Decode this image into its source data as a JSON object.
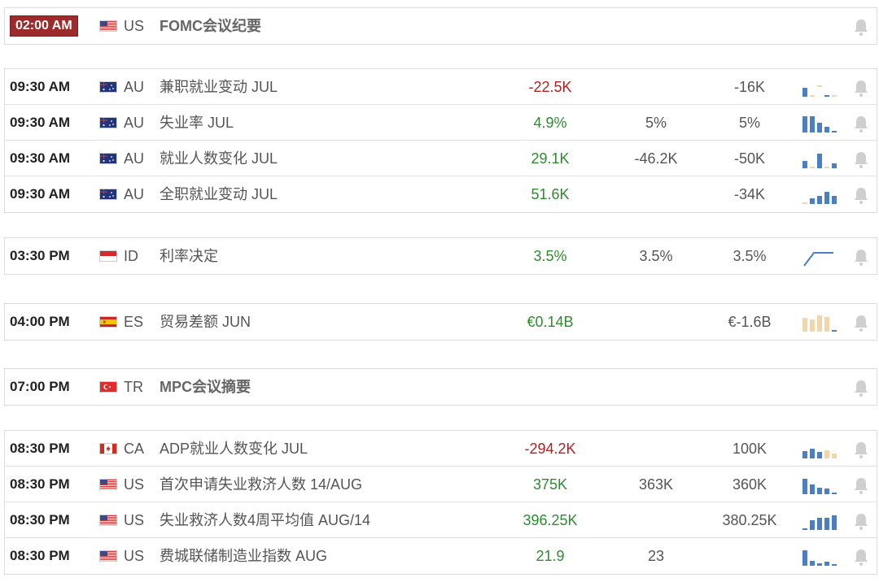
{
  "groups": [
    {
      "rows": [
        {
          "time": "02:00 AM",
          "highlight": true,
          "flag": "us",
          "country": "US",
          "event": "FOMC会议纪要",
          "bold": true,
          "actual": "",
          "forecast": "",
          "previous": "",
          "trend": "neg",
          "spark": []
        }
      ]
    },
    {
      "rows": [
        {
          "time": "09:30 AM",
          "flag": "au",
          "country": "AU",
          "event": "兼职就业变动 JUL",
          "actual": "-22.5K",
          "forecast": "",
          "previous": "-16K",
          "trend": "neg",
          "spark": [
            0.55,
            0.05,
            -0.35,
            0.08,
            0.08
          ],
          "sparkColors": [
            "b",
            "t",
            "t",
            "b",
            "t"
          ]
        },
        {
          "time": "09:30 AM",
          "flag": "au",
          "country": "AU",
          "event": "失业率 JUL",
          "actual": "4.9%",
          "forecast": "5%",
          "previous": "5%",
          "trend": "pos",
          "spark": [
            1.0,
            1.0,
            0.6,
            0.35,
            0.1
          ],
          "sparkColors": [
            "b",
            "b",
            "b",
            "b",
            "b"
          ]
        },
        {
          "time": "09:30 AM",
          "flag": "au",
          "country": "AU",
          "event": "就业人数变化 JUL",
          "actual": "29.1K",
          "forecast": "-46.2K",
          "previous": "-50K",
          "trend": "pos",
          "spark": [
            0.45,
            0.06,
            0.9,
            0.06,
            0.3
          ],
          "sparkColors": [
            "b",
            "t",
            "b",
            "t",
            "b"
          ]
        },
        {
          "time": "09:30 AM",
          "flag": "au",
          "country": "AU",
          "event": "全职就业变动 JUL",
          "actual": "51.6K",
          "forecast": "",
          "previous": "-34K",
          "trend": "pos",
          "spark": [
            0.1,
            0.35,
            0.5,
            0.75,
            0.5
          ],
          "sparkColors": [
            "t",
            "b",
            "b",
            "b",
            "b"
          ]
        }
      ]
    },
    {
      "rows": [
        {
          "time": "03:30 PM",
          "flag": "id",
          "country": "ID",
          "event": "利率决定",
          "actual": "3.5%",
          "forecast": "3.5%",
          "previous": "3.5%",
          "trend": "pos",
          "spark": "line"
        }
      ]
    },
    {
      "rows": [
        {
          "time": "04:00 PM",
          "flag": "es",
          "country": "ES",
          "event": "贸易差额 JUN",
          "actual": "€0.14B",
          "forecast": "",
          "previous": "€-1.6B",
          "trend": "pos",
          "spark": [
            0.85,
            0.75,
            1.0,
            0.9,
            0.1
          ],
          "sparkColors": [
            "t",
            "t",
            "t",
            "t",
            "b"
          ]
        }
      ]
    },
    {
      "rows": [
        {
          "time": "07:00 PM",
          "flag": "tr",
          "country": "TR",
          "event": "MPC会议摘要",
          "bold": true,
          "actual": "",
          "forecast": "",
          "previous": "",
          "trend": "neg",
          "spark": []
        }
      ]
    },
    {
      "rows": [
        {
          "time": "08:30 PM",
          "flag": "ca",
          "country": "CA",
          "event": "ADP就业人数变化 JUL",
          "actual": "-294.2K",
          "forecast": "",
          "previous": "100K",
          "trend": "neg",
          "spark": [
            0.45,
            0.6,
            0.4,
            0.5,
            0.3
          ],
          "sparkColors": [
            "b",
            "b",
            "b",
            "t",
            "t"
          ]
        },
        {
          "time": "08:30 PM",
          "flag": "us",
          "country": "US",
          "event": "首次申请失业救济人数 14/AUG",
          "actual": "375K",
          "forecast": "363K",
          "previous": "360K",
          "trend": "pos",
          "spark": [
            0.95,
            0.6,
            0.4,
            0.35,
            0.1
          ],
          "sparkColors": [
            "b",
            "b",
            "b",
            "b",
            "b"
          ]
        },
        {
          "time": "08:30 PM",
          "flag": "us",
          "country": "US",
          "event": "失业救济人数4周平均值 AUG/14",
          "actual": "396.25K",
          "forecast": "",
          "previous": "380.25K",
          "trend": "pos",
          "spark": [
            0.08,
            0.6,
            0.75,
            0.75,
            0.9
          ],
          "sparkColors": [
            "b",
            "b",
            "b",
            "b",
            "b"
          ]
        },
        {
          "time": "08:30 PM",
          "flag": "us",
          "country": "US",
          "event": "费城联储制造业指数 AUG",
          "actual": "21.9",
          "forecast": "23",
          "previous": "",
          "trend": "pos",
          "spark": [
            0.95,
            0.3,
            0.15,
            0.25,
            0.1
          ],
          "sparkColors": [
            "b",
            "b",
            "b",
            "b",
            "b"
          ]
        }
      ]
    }
  ],
  "colors": {
    "positive": "#2e8b2e",
    "negative": "#b02222",
    "sparkBlue": "#4a7fc1",
    "sparkTan": "#f0d6a8",
    "bell": "#cfcfcf",
    "highlight": "#9c2b2b"
  },
  "icons": {
    "alert": "bell-icon"
  }
}
